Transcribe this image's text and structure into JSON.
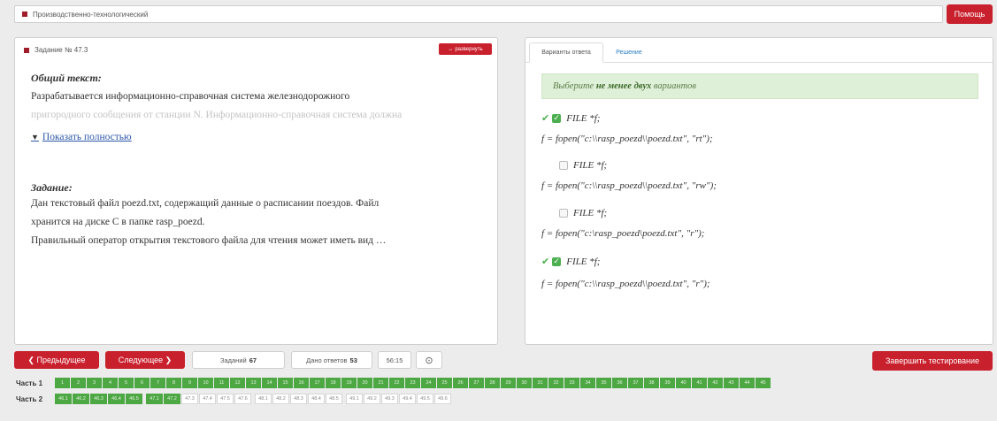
{
  "topbar": {
    "title": "Производственно-технологический",
    "help_label": "Помощь"
  },
  "task": {
    "header": "Задание № 47.3",
    "expand_label": "развернуть",
    "general_heading": "Общий текст:",
    "general_line1": "Разрабатывается информационно-справочная система железнодорожного",
    "general_line2": "пригородного сообщения от станции N. Информационно-справочная система должна",
    "show_full_label": "Показать полностью",
    "task_heading": "Задание:",
    "task_line1": "Дан текстовый файл poezd.txt, содержащий данные о расписании поездов. Файл",
    "task_line2": "хранится на диске С в папке rasp_poezd.",
    "task_line3": "Правильный оператор открытия текстового файла для чтения может иметь вид …"
  },
  "answers": {
    "tab_variants": "Варианты ответа",
    "tab_solution": "Решение",
    "hint_prefix": "Выберите",
    "hint_bold": "не менее двух",
    "hint_suffix": "вариантов",
    "options": [
      {
        "decl": "FILE *f;",
        "code": "f = fopen(\"c:\\\\rasp_poezd\\\\poezd.txt\", \"rt\");",
        "checked": true
      },
      {
        "decl": "FILE *f;",
        "code": "f = fopen(\"c:\\\\rasp_poezd\\\\poezd.txt\", \"rw\");",
        "checked": false
      },
      {
        "decl": "FILE *f;",
        "code": "f = fopen(\"c:\\rasp_poezd\\poezd.txt\", \"r\");",
        "checked": false
      },
      {
        "decl": "FILE *f;",
        "code": "f = fopen(\"c:\\\\rasp_poezd\\\\poezd.txt\", \"r\");",
        "checked": true
      }
    ]
  },
  "nav": {
    "prev_label": "❮ Предыдущее",
    "next_label": "Следующее ❯",
    "tasks_label": "Заданий",
    "tasks_count": "67",
    "answered_label": "Дано ответов",
    "answered_count": "53",
    "timer": "56:15",
    "finish_label": "Завершить тестирование"
  },
  "parts": {
    "part1_label": "Часть 1",
    "part2_label": "Часть 2",
    "part1": [
      "1",
      "2",
      "3",
      "4",
      "5",
      "6",
      "7",
      "8",
      "9",
      "10",
      "11",
      "12",
      "13",
      "14",
      "15",
      "16",
      "17",
      "18",
      "19",
      "20",
      "21",
      "22",
      "23",
      "24",
      "25",
      "26",
      "27",
      "28",
      "29",
      "30",
      "31",
      "32",
      "33",
      "34",
      "35",
      "36",
      "37",
      "38",
      "39",
      "40",
      "41",
      "42",
      "43",
      "44",
      "45"
    ],
    "part2_group1": [
      "46.1",
      "46.2",
      "46.3",
      "46.4",
      "46.5"
    ],
    "part2_group2": [
      "47.1",
      "47.2",
      "47.3",
      "47.4",
      "47.5",
      "47.6"
    ],
    "part2_group3": [
      "48.1",
      "48.2",
      "48.3",
      "48.4",
      "48.5"
    ],
    "part2_group4": [
      "49.1",
      "49.2",
      "49.3",
      "49.4",
      "49.5",
      "49.6"
    ],
    "part2_done_count": 7
  },
  "colors": {
    "accent_red": "#c9202d",
    "done_green": "#4da844",
    "hint_bg": "#dff0d8"
  }
}
